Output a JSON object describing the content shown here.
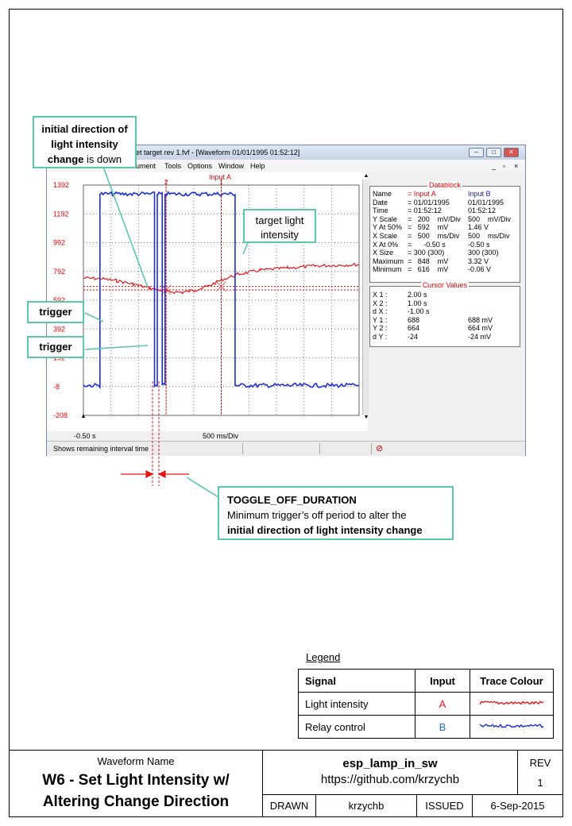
{
  "window": {
    "title": "et target rev 1.fvf - [Waveform  01/01/1995  01:52:12]",
    "menu": [
      "ument",
      "Tools",
      "Options",
      "Window",
      "Help"
    ],
    "status": "Shows remaining interval time"
  },
  "scope": {
    "channel_label": "Input A",
    "y_ticks": [
      "1392",
      "1192",
      "992",
      "792",
      "592",
      "392",
      "192",
      "-8",
      "-208"
    ],
    "x_start_label": "-0.50 s",
    "x_div_label": "500 ms/Div",
    "cursor_marks": [
      "2",
      "1"
    ]
  },
  "chart_data": {
    "type": "line",
    "title": "Input A",
    "xlabel": "500 ms/Div",
    "ylabel": "",
    "xlim": [
      -0.5,
      4.5
    ],
    "ylim": [
      -208,
      1392
    ],
    "series": [
      {
        "name": "Input A",
        "color": "#e8151b",
        "x": [
          -0.5,
          -0.2,
          0.1,
          0.4,
          0.7,
          1.0,
          1.3,
          1.5,
          1.75,
          2.0,
          2.3,
          2.7,
          3.2,
          3.7,
          4.5
        ],
        "values": [
          746,
          742,
          728,
          704,
          676,
          654,
          646,
          660,
          688,
          732,
          772,
          800,
          816,
          830,
          840
        ]
      },
      {
        "name": "Input B",
        "color": "#1d2fd8",
        "x": [
          -0.5,
          -0.2,
          -0.2,
          0.79,
          0.79,
          0.84,
          0.84,
          0.93,
          0.93,
          0.98,
          0.98,
          2.25,
          2.25,
          4.5
        ],
        "values": [
          0,
          0,
          1330,
          1330,
          0,
          0,
          1330,
          1330,
          0,
          0,
          1330,
          1330,
          0,
          0
        ]
      }
    ]
  },
  "datablock": {
    "title": "Datablock",
    "rows": [
      [
        "Name",
        "= Input A",
        "Input B"
      ],
      [
        "Date",
        "= 01/01/1995",
        "01/01/1995"
      ],
      [
        "Time",
        "= 01:52:12",
        "01:52:12"
      ],
      [
        "Y Scale",
        "=   200    mV/Div",
        "500    mV/Div"
      ],
      [
        "Y At 50%",
        "=   592    mV",
        "1.46 V"
      ],
      [
        "X Scale",
        "=   500    ms/Div",
        "500    ms/Div"
      ],
      [
        "X At 0%",
        "=      -0.50 s",
        "-0.50 s"
      ],
      [
        "X Size",
        "= 300 (300)",
        "300 (300)"
      ],
      [
        "Maximum",
        "=   848    mV",
        "3.32 V"
      ],
      [
        "Minimum",
        "=   616    mV",
        "-0.06 V"
      ]
    ]
  },
  "cursor_values": {
    "title": "Cursor Values",
    "rows": [
      [
        "X 1 :",
        "2.00 s",
        ""
      ],
      [
        "X 2 :",
        "1.00 s",
        ""
      ],
      [
        "d X :",
        "-1.00 s",
        ""
      ],
      [
        "Y 1 :",
        "688",
        "688 mV"
      ],
      [
        "Y 2 :",
        "664",
        "664 mV"
      ],
      [
        "d Y :",
        "-24",
        "-24 mV"
      ]
    ]
  },
  "callouts": {
    "initial_direction": {
      "bold": "initial direction of light intensity change",
      "normal": " is down"
    },
    "target": "target light intensity",
    "trigger1": "trigger",
    "trigger2": "trigger",
    "toggle_title": "TOGGLE_OFF_DURATION",
    "toggle_text": "Minimum  trigger’s off period to alter the",
    "toggle_bold": "initial direction of light intensity change"
  },
  "legend": {
    "caption": "Legend",
    "headers": [
      "Signal",
      "Input",
      "Trace Colour"
    ],
    "rows": [
      {
        "signal": "Light intensity",
        "input": "A",
        "color": "#e8151b"
      },
      {
        "signal": "Relay control",
        "input": "B",
        "color": "#1d2fd8"
      }
    ]
  },
  "titleblock": {
    "waveform_name_label": "Waveform Name",
    "waveform_name_line1": "W6 - Set Light Intensity w/",
    "waveform_name_line2": "Altering Change Direction",
    "project": "esp_lamp_in_sw",
    "url": "https://github.com/krzychb",
    "rev_label": "REV",
    "rev": "1",
    "drawn_label": "DRAWN",
    "drawn": "krzychb",
    "issued_label": "ISSUED",
    "issued": "6-Sep-2015"
  }
}
